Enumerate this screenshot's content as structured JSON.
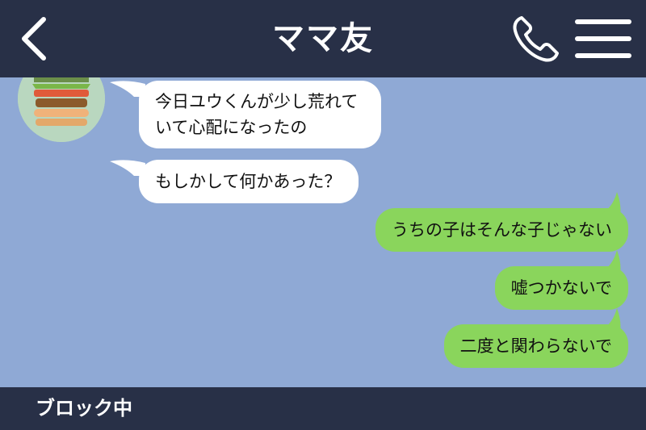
{
  "header": {
    "back_icon": "chevron-left-icon",
    "title": "ママ友",
    "call_icon": "phone-icon",
    "menu_icon": "hamburger-menu-icon"
  },
  "messages": [
    {
      "side": "incoming",
      "text": "今日ユウくんが少し荒れていて心配になったの"
    },
    {
      "side": "incoming",
      "text": "もしかして何かあった？"
    },
    {
      "side": "outgoing",
      "text": "うちの子はそんな子じゃない"
    },
    {
      "side": "outgoing",
      "text": "嘘つかないで"
    },
    {
      "side": "outgoing",
      "text": "二度と関わらないで"
    }
  ],
  "footer": {
    "status": "ブロック中"
  },
  "colors": {
    "header_bg": "#283047",
    "chat_bg": "#8fa9d5",
    "incoming_bubble": "#ffffff",
    "outgoing_bubble": "#8ad55c"
  }
}
